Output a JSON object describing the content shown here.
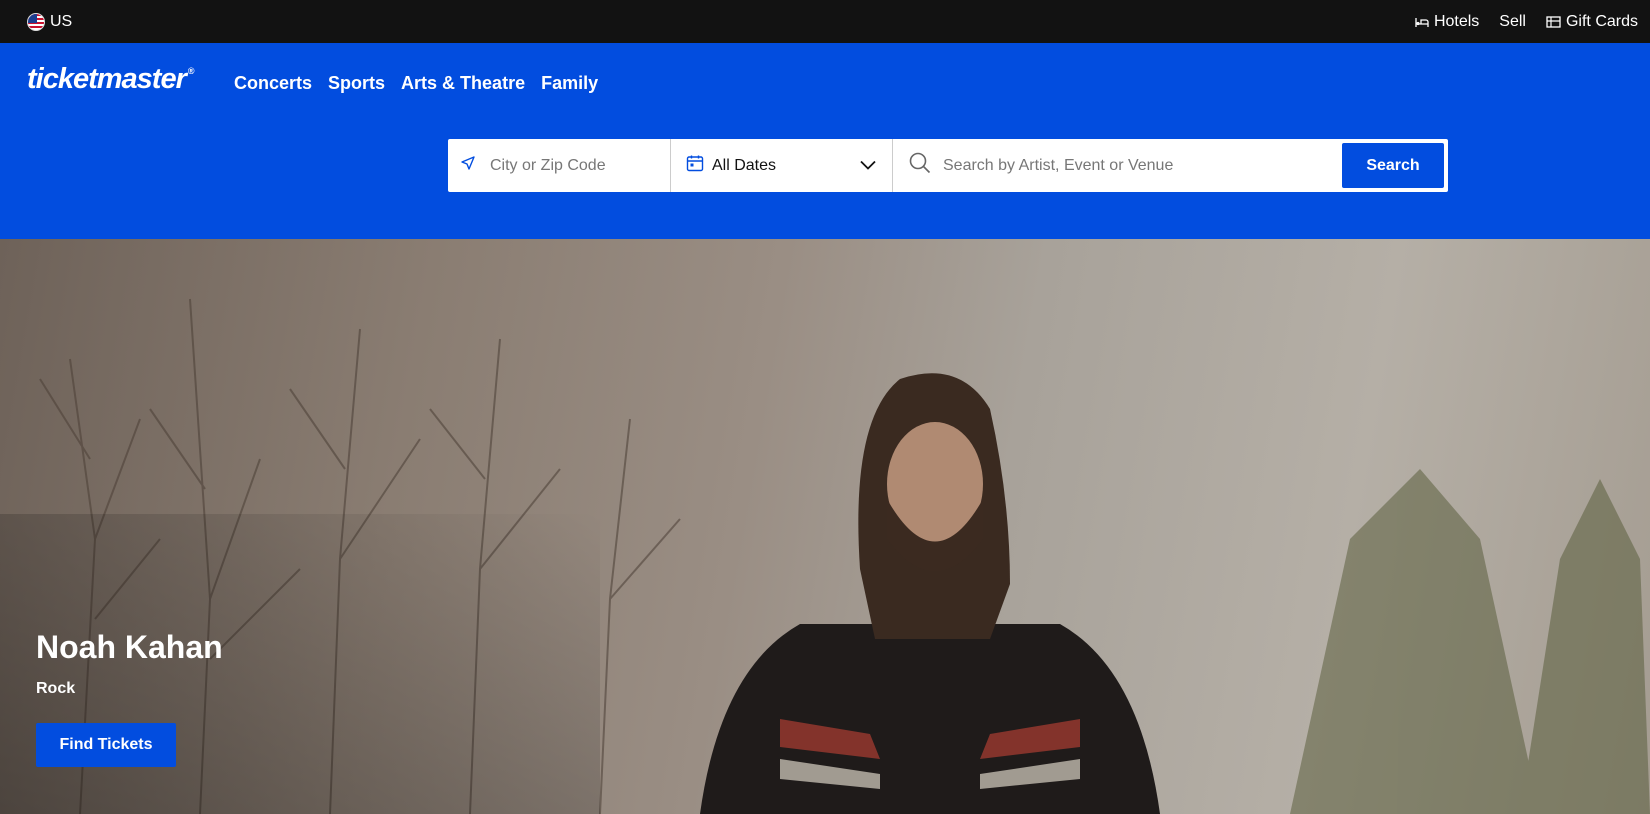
{
  "topbar": {
    "region": "US",
    "links": [
      {
        "label": "Hotels",
        "icon": "bed-icon"
      },
      {
        "label": "Sell",
        "icon": null
      },
      {
        "label": "Gift Cards",
        "icon": "gift-card-icon"
      }
    ]
  },
  "header": {
    "logo": "ticketmaster",
    "logo_mark": "®",
    "nav": [
      "Concerts",
      "Sports",
      "Arts & Theatre",
      "Family"
    ]
  },
  "search": {
    "location_placeholder": "City or Zip Code",
    "date_label": "All Dates",
    "query_placeholder": "Search by Artist, Event or Venue",
    "button_label": "Search"
  },
  "hero": {
    "title": "Noah Kahan",
    "genre": "Rock",
    "button_label": "Find Tickets"
  },
  "colors": {
    "brand": "#024ddf",
    "topbar": "#121212"
  }
}
